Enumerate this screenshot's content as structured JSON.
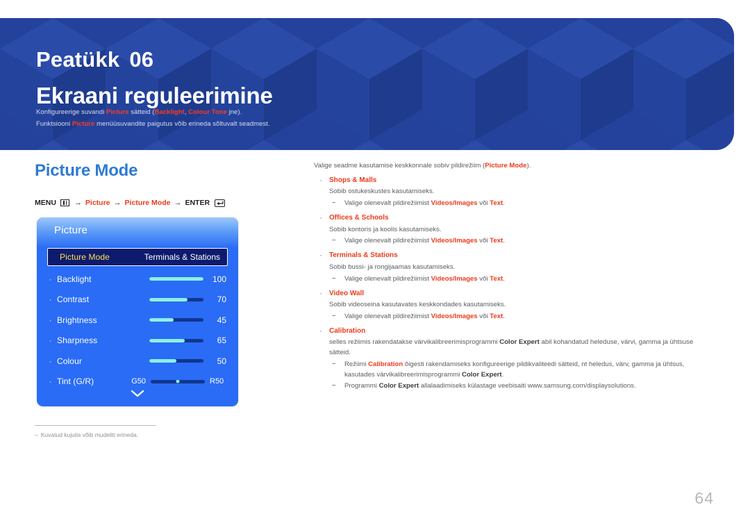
{
  "banner": {
    "chapter_label": "Peatükk",
    "chapter_number": "06",
    "title": "Ekraani reguleerimine",
    "note1": {
      "p1": "Konfigureerige suvandi ",
      "hl1": "Picture",
      "p2": " sätteid (",
      "hl2": "Backlight",
      "p3": ", ",
      "hl3": "Colour Tone",
      "p4": " jne)."
    },
    "note2": {
      "p1": "Funktsiooni ",
      "hl1": "Picture",
      "p2": " menüüsuvandite paigutus võib erineda sõltuvalt seadmest."
    },
    "bg_color": "#24429b",
    "accent_color": "#ff3b1f"
  },
  "left": {
    "section_title": "Picture Mode",
    "menu_path": {
      "menu_label": "MENU",
      "menu_icon": "menu-bars-icon",
      "arrow": "→",
      "item1": "Picture",
      "item2": "Picture Mode",
      "enter_label": "ENTER",
      "enter_icon": "enter-key-icon"
    },
    "osd": {
      "header": "Picture",
      "rows": [
        {
          "name": "Picture Mode",
          "type": "value",
          "value": "Terminals & Stations",
          "selected": true
        },
        {
          "name": "Backlight",
          "type": "slider",
          "value": "100",
          "fill": 100
        },
        {
          "name": "Contrast",
          "type": "slider",
          "value": "70",
          "fill": 70
        },
        {
          "name": "Brightness",
          "type": "slider",
          "value": "45",
          "fill": 45
        },
        {
          "name": "Sharpness",
          "type": "slider",
          "value": "65",
          "fill": 65
        },
        {
          "name": "Colour",
          "type": "slider",
          "value": "50",
          "fill": 50
        },
        {
          "name": "Tint (G/R)",
          "type": "tint",
          "left_label": "G50",
          "right_label": "R50",
          "knob": 50
        }
      ],
      "more_icon": "chevron-down-icon",
      "panel_color": "#2a6cf5",
      "selected_row_color": "#0d1b6e",
      "selected_label_color": "#ffe14d",
      "slider_fill_color": "#8ef0e0",
      "slider_track_color": "#11368f"
    },
    "footnote": {
      "dash": "–",
      "text": "Kuvatud kujutis võib mudeliti erineda."
    }
  },
  "right": {
    "lead": {
      "p1": "Valige seadme kasutamise keskkonnale sobiv pildirežiim (",
      "hl1": "Picture Mode",
      "p2": ")."
    },
    "sub_common": {
      "p1": "Valige olenevalt pildirežiimist ",
      "hl1": "Videos/Images",
      "p2": " või ",
      "hl2": "Text",
      "p3": "."
    },
    "items": [
      {
        "title": "Shops & Malls",
        "desc": "Sobib ostukeskustes kasutamiseks."
      },
      {
        "title": "Offices & Schools",
        "desc": "Sobib kontoris ja koolis kasutamiseks."
      },
      {
        "title": "Terminals & Stations",
        "desc": "Sobib bussi- ja rongijaamas kasutamiseks."
      },
      {
        "title": "Video Wall",
        "desc": "Sobib videoseina kasutavates keskkondades kasutamiseks."
      }
    ],
    "calibration": {
      "title": "Calibration",
      "desc_p1": "selles režiimis rakendatakse värvikalibreerimisprogrammi ",
      "desc_b1": "Color Expert",
      "desc_p2": " abil kohandatud heleduse, värvi, gamma ja ühtsuse sätteid.",
      "sub1_p1": "Režiimi ",
      "sub1_r1": "Calibration",
      "sub1_p2": " õigesti rakendamiseks konfigureerige pildikvaliteedi sätteid, nt heledus, värv, gamma ja ühtsus, kasutades värvikalibreerimisprogrammi ",
      "sub1_b1": "Color Expert",
      "sub1_p3": ".",
      "sub2_p1": "Programmi ",
      "sub2_b1": "Color Expert",
      "sub2_p2": " allalaadimiseks külastage veebisaiti www.samsung.com/displaysolutions."
    }
  },
  "page_number": "64"
}
